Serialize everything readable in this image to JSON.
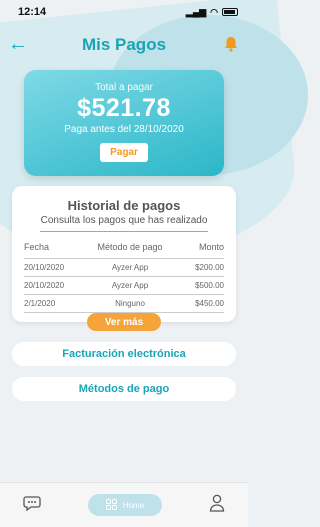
{
  "status_bar": {
    "time": "12:14"
  },
  "header": {
    "title": "Mis Pagos"
  },
  "payment": {
    "label": "Total a pagar",
    "amount": "$521.78",
    "due": "Paga antes del 28/10/2020",
    "button": "Pagar"
  },
  "history": {
    "title": "Historial de pagos",
    "subtitle": "Consulta los pagos que has realizado",
    "columns": [
      "Fecha",
      "Método de pago",
      "Monto"
    ],
    "rows": [
      [
        "20/10/2020",
        "Ayzer App",
        "$200.00"
      ],
      [
        "20/10/2020",
        "Ayzer App",
        "$500.00"
      ],
      [
        "2/1/2020",
        "Ninguno",
        "$450.00"
      ]
    ],
    "more_button": "Ver más"
  },
  "links": {
    "billing": "Facturación electrónica",
    "methods": "Métodos de pago"
  },
  "nav": {
    "home": "Home"
  },
  "colors": {
    "accent": "#18a5b5",
    "orange": "#f39a1e"
  }
}
